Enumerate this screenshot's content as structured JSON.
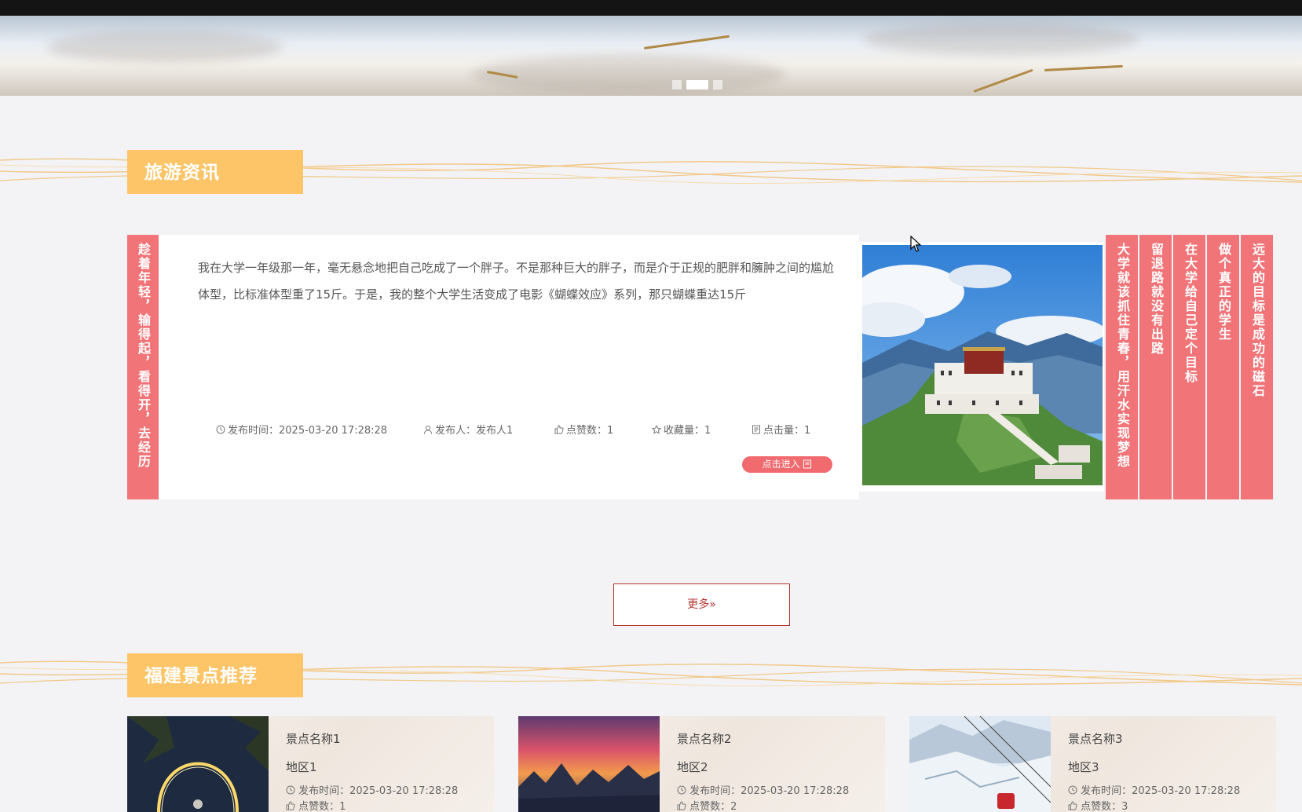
{
  "banner": {
    "slides": 3,
    "active_slide": 2
  },
  "news_section": {
    "title": "旅游资讯",
    "left_banner": "趁着年轻，输得起，看得开，去经历",
    "article": {
      "excerpt": "我在大学一年级那一年，毫无悬念地把自己吃成了一个胖子。不是那种巨大的胖子，而是介于正规的肥胖和臃肿之间的尴尬体型，比标准体型重了15斤。于是，我的整个大学生活变成了电影《蝴蝶效应》系列，那只蝴蝶重达15斤",
      "publish_time": "发布时间：2025-03-20 17:28:28",
      "publisher": "发布人：发布人1",
      "likes": "点赞数：1",
      "favorites": "收藏量：1",
      "clicks": "点击量：1",
      "enter_label": "点击进入"
    },
    "right_banners": [
      "大学就该抓住青春，用汗水实现梦想",
      "留退路就没有出路",
      "在大学给自己定个目标",
      "做个真正的学生",
      "远大的目标是成功的磁石"
    ],
    "more_label": "更多»"
  },
  "spots_section": {
    "title": "福建景点推荐",
    "items": [
      {
        "name": "景点名称1",
        "region": "地区1",
        "time": "发布时间：2025-03-20 17:28:28",
        "likes": "点赞数：1"
      },
      {
        "name": "景点名称2",
        "region": "地区2",
        "time": "发布时间：2025-03-20 17:28:28",
        "likes": "点赞数：2"
      },
      {
        "name": "景点名称3",
        "region": "地区3",
        "time": "发布时间：2025-03-20 17:28:28",
        "likes": "点赞数：3"
      }
    ]
  },
  "colors": {
    "section_title": "#fdc567",
    "accent_red": "#f07478",
    "more_border": "#b83430",
    "page_bg": "#f3f3f6"
  }
}
